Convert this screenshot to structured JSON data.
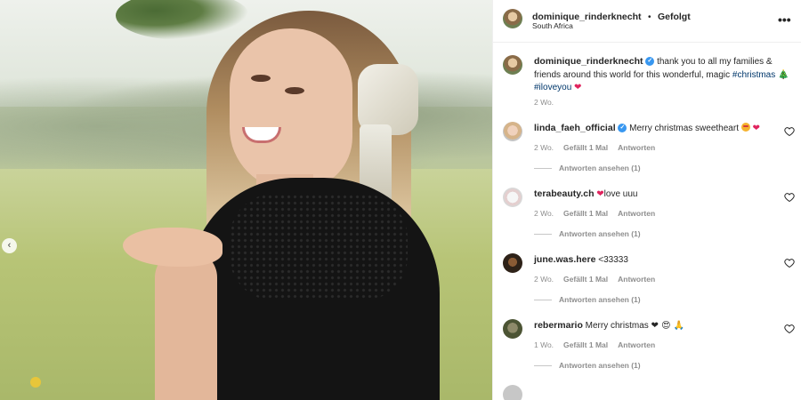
{
  "photo": {
    "carousel_prev_glyph": "‹"
  },
  "post_header": {
    "username": "dominique_rinderknecht",
    "separator": "•",
    "follow_state": "Gefolgt",
    "location": "South Africa",
    "more_glyph": "•••"
  },
  "caption": {
    "username": "dominique_rinderknecht",
    "text_before": " thank you to all my families & friends around this world for this wonderful, magic ",
    "hashtag1": "#christmas",
    "emoji1": "🎄",
    "hashtag2": "#iloveyou",
    "heart_emoji": "❤",
    "time": "2 Wo."
  },
  "comments": [
    {
      "username": "linda_faeh_official",
      "verified": true,
      "text": " Merry christmas sweetheart ",
      "emoji_a": "😍",
      "emoji_b": "❤",
      "time": "2 Wo.",
      "likes": "Gefällt 1 Mal",
      "reply": "Antworten",
      "view_replies": "Antworten ansehen (1)"
    },
    {
      "username": "terabeauty.ch",
      "text_prefix": "❤",
      "text": "love uuu",
      "time": "2 Wo.",
      "likes": "Gefällt 1 Mal",
      "reply": "Antworten",
      "view_replies": "Antworten ansehen (1)"
    },
    {
      "username": "june.was.here",
      "text": " <33333",
      "time": "2 Wo.",
      "likes": "Gefällt 1 Mal",
      "reply": "Antworten",
      "view_replies": "Antworten ansehen (1)"
    },
    {
      "username": "rebermario",
      "text": " Merry christmas ",
      "emojis": "❤ 😍 🙏",
      "time": "1 Wo.",
      "likes": "Gefällt 1 Mal",
      "reply": "Antworten",
      "view_replies": "Antworten ansehen (1)"
    }
  ],
  "colors": {
    "link": "#00376b",
    "verified": "#3897f0",
    "muted": "#8e8e8e",
    "heart": "#e0245e"
  },
  "icons": [
    "verified-badge-icon",
    "more-options-icon",
    "heart-outline-icon",
    "chevron-left-icon"
  ]
}
